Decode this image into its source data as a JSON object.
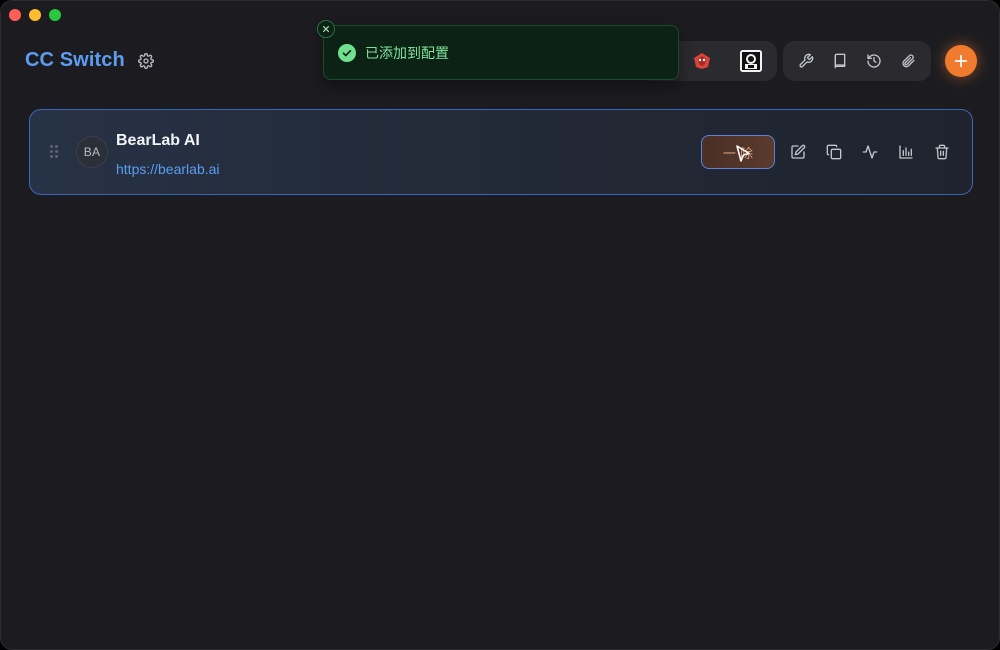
{
  "app": {
    "title": "CC Switch"
  },
  "toast": {
    "message": "已添加到配置",
    "color": "#7fe39b"
  },
  "header": {
    "accent_color": "#5b9df0",
    "add_button_color": "#f07a2e",
    "tools": [
      "wrench-icon",
      "book-icon",
      "history-icon",
      "paperclip-icon"
    ]
  },
  "provider": {
    "avatar_initials": "BA",
    "name": "BearLab AI",
    "url": "https://bearlab.ai",
    "enable_label": "一 除",
    "actions": [
      "edit-icon",
      "copy-icon",
      "activity-icon",
      "chart-icon",
      "trash-icon"
    ]
  }
}
